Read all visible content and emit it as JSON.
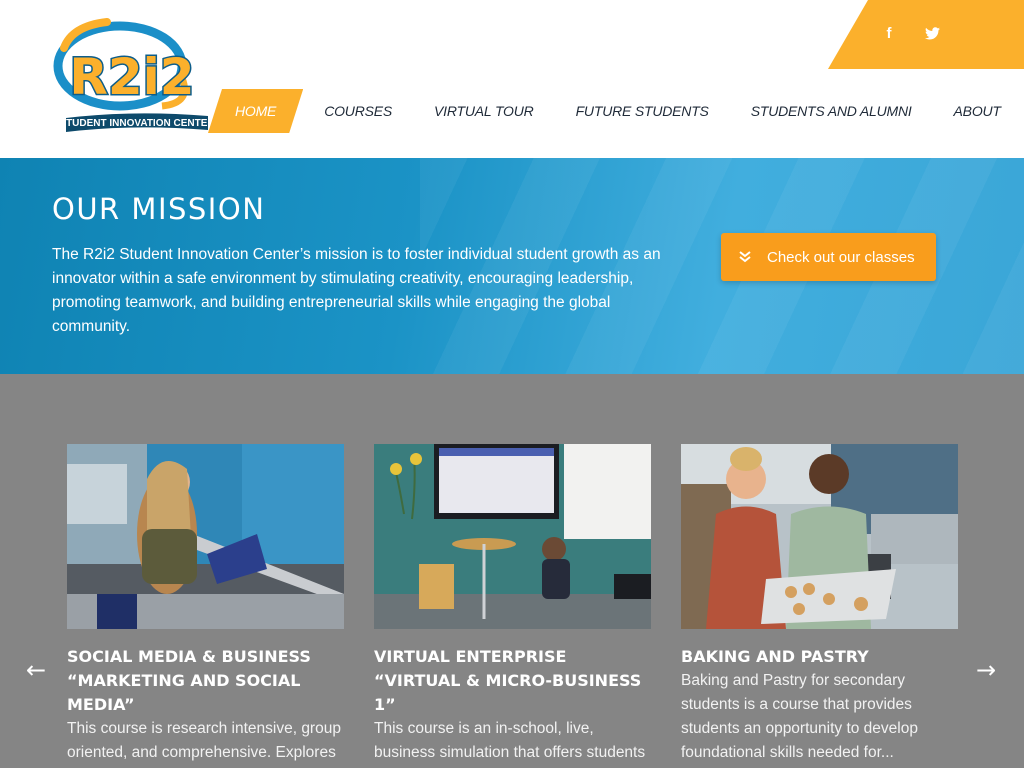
{
  "social": {
    "facebook": "f",
    "twitter_icon": "twitter-icon"
  },
  "logo": {
    "text": "R2i2",
    "subtitle": "STUDENT INNOVATION CENTER"
  },
  "nav": {
    "items": [
      {
        "label": "HOME",
        "active": true
      },
      {
        "label": "COURSES"
      },
      {
        "label": "VIRTUAL TOUR"
      },
      {
        "label": "FUTURE STUDENTS"
      },
      {
        "label": "STUDENTS AND ALUMNI"
      },
      {
        "label": "ABOUT"
      }
    ]
  },
  "mission": {
    "title": "OUR MISSION",
    "text": "The R2i2 Student Innovation Center’s mission is to foster individual student growth as an innovator within a safe environment by stimulating creativity, encouraging leadership, promoting teamwork, and building entrepreneurial skills while engaging the global community.",
    "cta_label": "Check out our classes",
    "cta_icon": "double-chevron-down-icon"
  },
  "courses": {
    "prev_arrow": "←",
    "next_arrow": "→",
    "items": [
      {
        "title": "SOCIAL MEDIA & BUSINESS “MARKETING AND SOCIAL MEDIA”",
        "desc": "This course is research intensive, group oriented, and comprehensive. Explores"
      },
      {
        "title": "VIRTUAL ENTERPRISE “VIRTUAL & MICRO-BUSINESS 1”",
        "desc": "This course is an in-school, live, business simulation that offers students a competitive edge through project-"
      },
      {
        "title": "BAKING AND PASTRY",
        "desc": "Baking and Pastry for secondary students is a course that provides students an opportunity to develop foundational skills needed for..."
      }
    ]
  },
  "colors": {
    "accent": "#fbb02c",
    "mission_blue": "#1b93c6",
    "courses_gray": "#858585"
  }
}
